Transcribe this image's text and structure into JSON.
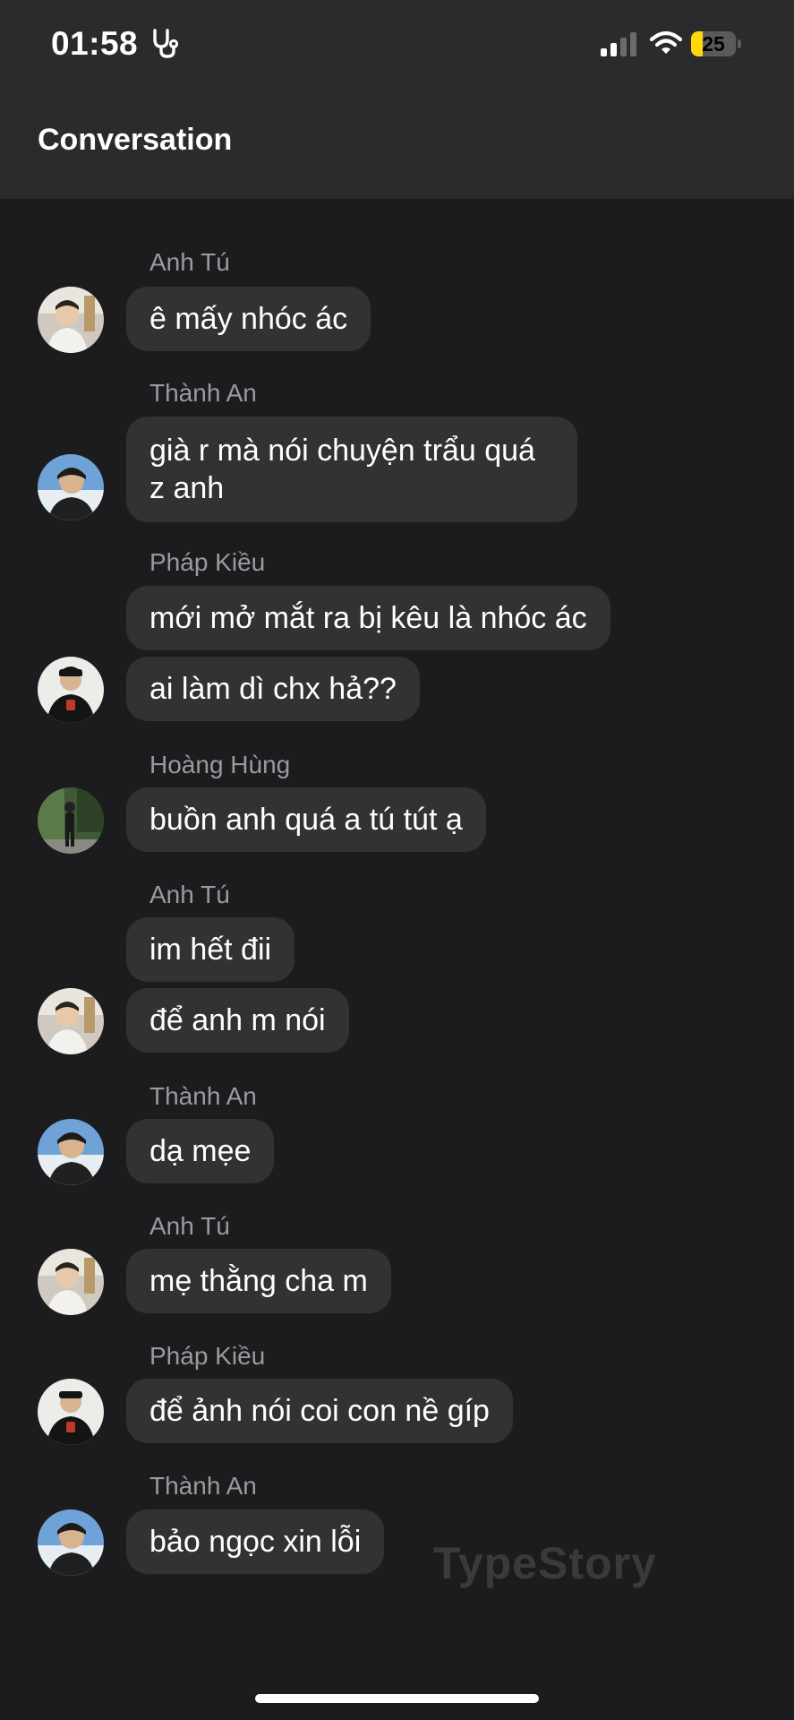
{
  "status_bar": {
    "time": "01:58",
    "battery": "25",
    "battery_level": 0.25
  },
  "header": {
    "title": "Conversation"
  },
  "messages": [
    {
      "sender": "Anh Tú",
      "bubbles": [
        "ê mấy nhóc ác"
      ]
    },
    {
      "sender": "Thành An",
      "bubbles": [
        "già r mà nói chuyện trẩu quá z anh"
      ]
    },
    {
      "sender": "Pháp Kiều",
      "bubbles": [
        "mới mở mắt ra bị kêu là nhóc ác",
        "ai làm dì chx hả??"
      ]
    },
    {
      "sender": "Hoàng Hùng",
      "bubbles": [
        "buồn anh quá a tú tút ạ"
      ]
    },
    {
      "sender": "Anh Tú",
      "bubbles": [
        "im hết đii",
        "để anh m nói"
      ]
    },
    {
      "sender": "Thành An",
      "bubbles": [
        "dạ mẹe"
      ]
    },
    {
      "sender": "Anh Tú",
      "bubbles": [
        "mẹ thằng cha m"
      ]
    },
    {
      "sender": "Pháp Kiều",
      "bubbles": [
        "để ảnh nói coi con nề gíp"
      ]
    },
    {
      "sender": "Thành An",
      "bubbles": [
        "bảo ngọc xin lỗi"
      ]
    }
  ],
  "watermark": "TypeStory",
  "colors": {
    "background": "#1c1c1e",
    "header": "#2b2b2d",
    "bubble": "#323234",
    "sender_name": "#9a9a9f",
    "battery": "#ffd60a"
  }
}
